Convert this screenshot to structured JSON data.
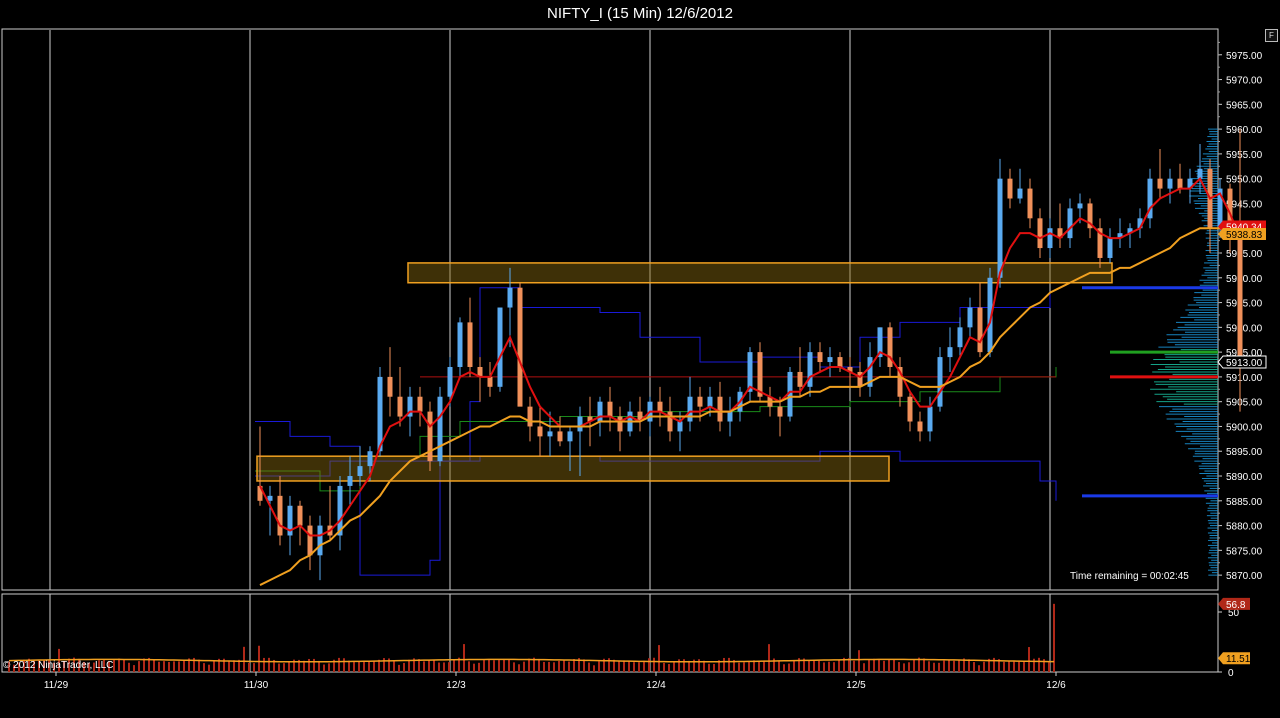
{
  "header": {
    "title": "NIFTY_I (15 Min)  12/6/2012",
    "panel_button": "F"
  },
  "footer": {
    "copyright": "© 2012 NinjaTrader, LLC",
    "time_remaining": "Time remaining = 00:02:45"
  },
  "colors": {
    "background": "#000000",
    "up_candle": "#5aaaf0",
    "down_candle": "#f0905a",
    "fast_ma": "#e01010",
    "slow_ma": "#f0a020",
    "vwap_upper": "#1a1ad8",
    "vwap_mid": "#1a8a1a",
    "zone_fill": "#8a6a10",
    "zone_border": "#f0a020",
    "volume_bar": "#b02818",
    "volume_ma": "#f0a020",
    "profile": "#1b9ae0"
  },
  "chart_data": {
    "type": "candlestick",
    "title": "NIFTY_I (15 Min)  12/6/2012",
    "symbol": "NIFTY_I",
    "interval": "15 Min",
    "x_tick_labels": [
      "11/29",
      "11/30",
      "12/3",
      "12/4",
      "12/5",
      "12/6"
    ],
    "y_tick_labels": [
      "5975.00",
      "5970.00",
      "5965.00",
      "5960.00",
      "5955.00",
      "5950.00",
      "5945.00",
      "5940.00",
      "5935.00",
      "5930.00",
      "5925.00",
      "5920.00",
      "5915.00",
      "5910.00",
      "5905.00",
      "5900.00",
      "5895.00",
      "5890.00",
      "5885.00",
      "5880.00",
      "5875.00",
      "5870.00"
    ],
    "ylim": [
      5867,
      5980
    ],
    "grid": "vertical at session starts",
    "candles_ohlc": [
      [
        5888,
        5900,
        5884,
        5885
      ],
      [
        5885,
        5888,
        5878,
        5886
      ],
      [
        5886,
        5890,
        5876,
        5878
      ],
      [
        5878,
        5886,
        5874,
        5884
      ],
      [
        5884,
        5885,
        5876,
        5880
      ],
      [
        5880,
        5882,
        5871,
        5874
      ],
      [
        5874,
        5882,
        5869,
        5880
      ],
      [
        5880,
        5888,
        5877,
        5878
      ],
      [
        5878,
        5890,
        5875,
        5888
      ],
      [
        5888,
        5894,
        5884,
        5890
      ],
      [
        5890,
        5896,
        5888,
        5892
      ],
      [
        5892,
        5896,
        5889,
        5895
      ],
      [
        5895,
        5912,
        5894,
        5910
      ],
      [
        5910,
        5916,
        5902,
        5906
      ],
      [
        5906,
        5912,
        5900,
        5902
      ],
      [
        5902,
        5908,
        5898,
        5906
      ],
      [
        5906,
        5908,
        5900,
        5903
      ],
      [
        5903,
        5905,
        5891,
        5893
      ],
      [
        5893,
        5908,
        5892,
        5906
      ],
      [
        5906,
        5914,
        5904,
        5912
      ],
      [
        5912,
        5922,
        5910,
        5921
      ],
      [
        5921,
        5926,
        5910,
        5912
      ],
      [
        5912,
        5914,
        5905,
        5910
      ],
      [
        5910,
        5913,
        5906,
        5908
      ],
      [
        5908,
        5924,
        5907,
        5924
      ],
      [
        5924,
        5932,
        5916,
        5928
      ],
      [
        5928,
        5929,
        5907,
        5904
      ],
      [
        5904,
        5906,
        5897,
        5900
      ],
      [
        5900,
        5904,
        5894,
        5898
      ],
      [
        5898,
        5903,
        5894,
        5899
      ],
      [
        5899,
        5902,
        5896,
        5897
      ],
      [
        5897,
        5900,
        5891,
        5899
      ],
      [
        5899,
        5904,
        5890,
        5902
      ],
      [
        5902,
        5906,
        5896,
        5901
      ],
      [
        5901,
        5906,
        5898,
        5905
      ],
      [
        5905,
        5908,
        5899,
        5902
      ],
      [
        5902,
        5904,
        5895,
        5899
      ],
      [
        5899,
        5905,
        5898,
        5903
      ],
      [
        5903,
        5906,
        5899,
        5901
      ],
      [
        5901,
        5906,
        5898,
        5905
      ],
      [
        5905,
        5908,
        5900,
        5903
      ],
      [
        5903,
        5906,
        5897,
        5899
      ],
      [
        5899,
        5903,
        5895,
        5901
      ],
      [
        5901,
        5910,
        5899,
        5906
      ],
      [
        5906,
        5908,
        5901,
        5904
      ],
      [
        5904,
        5908,
        5902,
        5906
      ],
      [
        5906,
        5909,
        5899,
        5901
      ],
      [
        5901,
        5906,
        5898,
        5903
      ],
      [
        5903,
        5908,
        5901,
        5907
      ],
      [
        5907,
        5916,
        5905,
        5915
      ],
      [
        5915,
        5917,
        5905,
        5906
      ],
      [
        5906,
        5908,
        5902,
        5904
      ],
      [
        5904,
        5906,
        5898,
        5902
      ],
      [
        5902,
        5912,
        5901,
        5911
      ],
      [
        5911,
        5916,
        5906,
        5908
      ],
      [
        5908,
        5917,
        5906,
        5915
      ],
      [
        5915,
        5917,
        5911,
        5913
      ],
      [
        5913,
        5916,
        5910,
        5914
      ],
      [
        5914,
        5915,
        5911,
        5912
      ],
      [
        5912,
        5914,
        5908,
        5911
      ],
      [
        5911,
        5913,
        5906,
        5908
      ],
      [
        5908,
        5917,
        5906,
        5914
      ],
      [
        5914,
        5920,
        5912,
        5920
      ],
      [
        5920,
        5921,
        5910,
        5912
      ],
      [
        5912,
        5914,
        5904,
        5906
      ],
      [
        5906,
        5907,
        5899,
        5901
      ],
      [
        5901,
        5903,
        5897,
        5899
      ],
      [
        5899,
        5906,
        5897,
        5904
      ],
      [
        5904,
        5916,
        5903,
        5914
      ],
      [
        5914,
        5920,
        5911,
        5916
      ],
      [
        5916,
        5922,
        5914,
        5920
      ],
      [
        5920,
        5926,
        5918,
        5924
      ],
      [
        5924,
        5929,
        5914,
        5915
      ],
      [
        5915,
        5932,
        5914,
        5930
      ],
      [
        5930,
        5954,
        5928,
        5950
      ],
      [
        5950,
        5952,
        5944,
        5946
      ],
      [
        5946,
        5952,
        5945,
        5948
      ],
      [
        5948,
        5950,
        5940,
        5942
      ],
      [
        5942,
        5944,
        5934,
        5936
      ],
      [
        5936,
        5942,
        5934,
        5940
      ],
      [
        5940,
        5945,
        5936,
        5938
      ],
      [
        5938,
        5946,
        5936,
        5944
      ],
      [
        5944,
        5947,
        5941,
        5945
      ],
      [
        5945,
        5946,
        5938,
        5940
      ],
      [
        5940,
        5942,
        5932,
        5934
      ],
      [
        5934,
        5940,
        5933,
        5938
      ],
      [
        5938,
        5942,
        5936,
        5939
      ],
      [
        5939,
        5941,
        5936,
        5940
      ],
      [
        5940,
        5944,
        5938,
        5942
      ],
      [
        5942,
        5952,
        5940,
        5950
      ],
      [
        5950,
        5956,
        5946,
        5948
      ],
      [
        5948,
        5952,
        5945,
        5950
      ],
      [
        5950,
        5953,
        5947,
        5948
      ],
      [
        5948,
        5952,
        5945,
        5950
      ],
      [
        5950,
        5957,
        5947,
        5952
      ],
      [
        5952,
        5954,
        5935,
        5940
      ],
      [
        5940,
        5950,
        5938,
        5948
      ],
      [
        5948,
        5949,
        5935,
        5938
      ],
      [
        5938,
        5960,
        5903,
        5913
      ]
    ],
    "series": [
      {
        "name": "",
        "values": [
          5888,
          5884,
          5880,
          5879,
          5880,
          5878,
          5878,
          5879,
          5881,
          5884,
          5887,
          5890,
          5896,
          5900,
          5901,
          5903,
          5903,
          5900,
          5902,
          5905,
          5910,
          5911,
          5910,
          5910,
          5914,
          5918,
          5913,
          5908,
          5904,
          5902,
          5900,
          5900,
          5900,
          5901,
          5902,
          5902,
          5901,
          5902,
          5901,
          5903,
          5903,
          5902,
          5901,
          5903,
          5903,
          5904,
          5903,
          5903,
          5905,
          5908,
          5907,
          5906,
          5905,
          5907,
          5907,
          5910,
          5911,
          5912,
          5912,
          5911,
          5910,
          5912,
          5915,
          5914,
          5911,
          5907,
          5904,
          5904,
          5907,
          5910,
          5914,
          5918,
          5917,
          5921,
          5931,
          5936,
          5939,
          5939,
          5938,
          5939,
          5938,
          5940,
          5942,
          5941,
          5939,
          5938,
          5938,
          5939,
          5940,
          5944,
          5946,
          5947,
          5948,
          5948,
          5950,
          5946,
          5947,
          5943,
          5938
        ]
      },
      {
        "name": "",
        "values": [
          5868,
          5869,
          5870,
          5871,
          5873,
          5874,
          5876,
          5877,
          5879,
          5881,
          5882,
          5884,
          5886,
          5889,
          5891,
          5893,
          5894,
          5895,
          5896,
          5897,
          5898,
          5899,
          5900,
          5900,
          5901,
          5902,
          5902,
          5901,
          5901,
          5900,
          5900,
          5900,
          5900,
          5900,
          5901,
          5901,
          5901,
          5901,
          5901,
          5902,
          5902,
          5902,
          5902,
          5902,
          5902,
          5903,
          5903,
          5903,
          5904,
          5905,
          5905,
          5905,
          5905,
          5906,
          5906,
          5907,
          5907,
          5908,
          5908,
          5908,
          5908,
          5909,
          5910,
          5910,
          5910,
          5909,
          5908,
          5908,
          5908,
          5909,
          5910,
          5912,
          5913,
          5915,
          5918,
          5920,
          5922,
          5924,
          5925,
          5927,
          5928,
          5929,
          5930,
          5931,
          5931,
          5931,
          5932,
          5932,
          5933,
          5934,
          5935,
          5936,
          5938,
          5939,
          5940,
          5940,
          5940,
          5940,
          5939
        ]
      }
    ],
    "levels": [
      {
        "kind": "zone",
        "low": 5929,
        "high": 5933
      },
      {
        "kind": "zone",
        "low": 5889,
        "high": 5894
      }
    ],
    "price_labels": [
      "5940.34",
      "5938.83",
      "5913.00"
    ],
    "volume": {
      "y_tick_labels": [
        "50",
        "0"
      ],
      "ylim": [
        0,
        60
      ],
      "values_label_last": "56.8",
      "ma_label": "11.51"
    }
  }
}
